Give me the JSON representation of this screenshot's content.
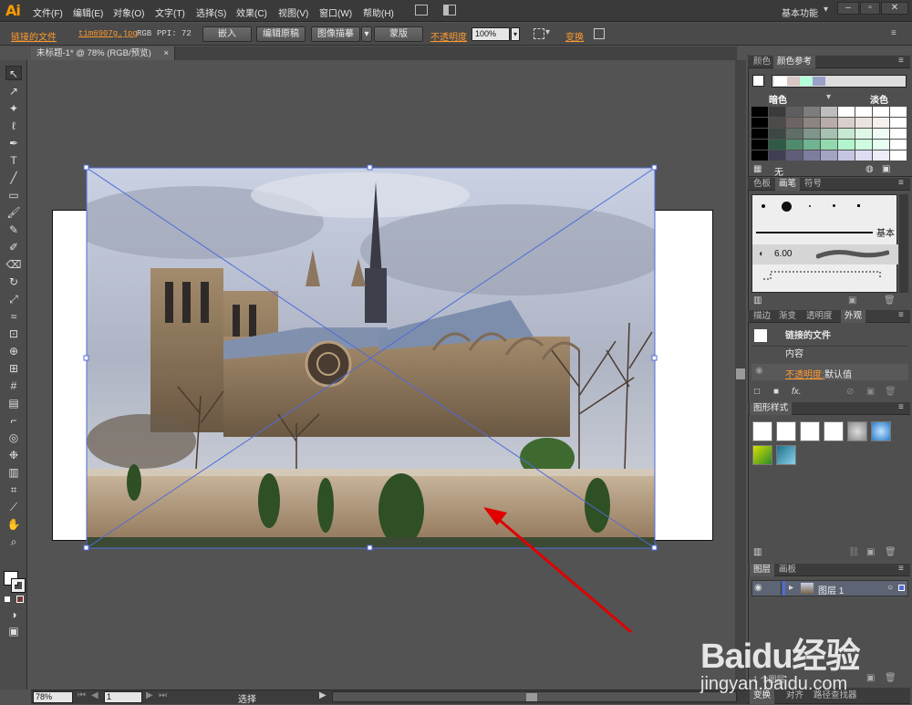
{
  "app": {
    "logo": "Ai",
    "workspace": "基本功能"
  },
  "menu": [
    "文件(F)",
    "编辑(E)",
    "对象(O)",
    "文字(T)",
    "选择(S)",
    "效果(C)",
    "视图(V)",
    "窗口(W)",
    "帮助(H)"
  ],
  "control": {
    "linked_file": "链接的文件",
    "file_name": "tim6907g.jpg",
    "color_mode": "RGB",
    "ppi": "PPI: 72",
    "embed": "嵌入",
    "edit_original": "编辑原稿",
    "image_trace": "图像描摹",
    "mask": "蒙版",
    "opacity_label": "不透明度",
    "opacity_value": "100%",
    "transform": "变换"
  },
  "document": {
    "tab_title": "未标题-1* @ 78% (RGB/预览)",
    "tab_close": "×"
  },
  "panels": {
    "color_tabs": [
      "颜色",
      "颜色参考"
    ],
    "color_dark": "暗色",
    "color_light": "淡色",
    "color_none": "无",
    "swatch_colors": [
      [
        "#000000",
        "#3b3b3b",
        "#5e5e5e",
        "#7d7d7d",
        "#bdbdbd",
        "#ffffff",
        "#ffffff",
        "#ffffff",
        "#ffffff"
      ],
      [
        "#000000",
        "#4f4a4a",
        "#6d6563",
        "#8c8480",
        "#b8aca9",
        "#d9cfcc",
        "#ebe3e0",
        "#f5f0ee",
        "#ffffff"
      ],
      [
        "#000000",
        "#3d4743",
        "#5f6e66",
        "#7f948a",
        "#a7c0b1",
        "#c7e8d2",
        "#dff7e7",
        "#eefcf3",
        "#ffffff"
      ],
      [
        "#000000",
        "#2f5a45",
        "#4f8a6c",
        "#6fb390",
        "#93d9b0",
        "#b3f5cc",
        "#cdfce0",
        "#e6fff0",
        "#ffffff"
      ],
      [
        "#000000",
        "#3f3f54",
        "#5e5e7a",
        "#7d7da0",
        "#a3a3c4",
        "#c6c6e3",
        "#dcdcf2",
        "#ededf9",
        "#ffffff"
      ]
    ],
    "ref_swatches": [
      "#ffffff",
      "#d8c7c2",
      "#b3ffd9",
      "#9aa0c8"
    ],
    "brush_tabs": [
      "色板",
      "画笔",
      "符号"
    ],
    "brush_basic": "基本",
    "brush_size": "6.00",
    "appearance_tabs": [
      "描边",
      "渐变",
      "透明度",
      "外观"
    ],
    "appearance_title": "链接的文件",
    "appearance_content": "内容",
    "appearance_opacity": "不透明度:",
    "appearance_default": "默认值",
    "graphic_styles_title": "图形样式",
    "layers_tabs": [
      "图层",
      "画板"
    ],
    "layer_name": "图层 1",
    "layers_count": "1 个图层",
    "bottom_tabs": [
      "变换",
      "对齐",
      "路径查找器"
    ]
  },
  "status": {
    "zoom": "78%",
    "page": "1",
    "tool": "选择"
  },
  "watermark": {
    "brand": "Baidu经验",
    "url": "jingyan.baidu.com"
  }
}
